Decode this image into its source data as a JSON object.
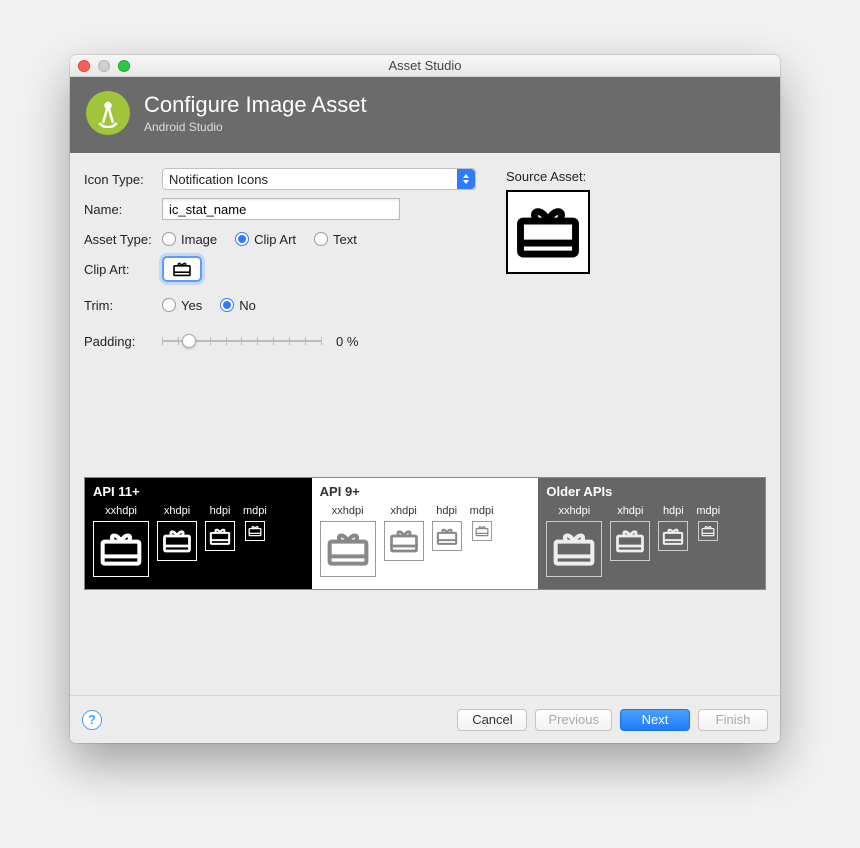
{
  "window": {
    "title": "Asset Studio"
  },
  "header": {
    "title": "Configure Image Asset",
    "subtitle": "Android Studio"
  },
  "form": {
    "iconType": {
      "label": "Icon Type:",
      "value": "Notification Icons"
    },
    "name": {
      "label": "Name:",
      "value": "ic_stat_name"
    },
    "assetType": {
      "label": "Asset Type:",
      "options": {
        "image": "Image",
        "clipArt": "Clip Art",
        "text": "Text"
      },
      "selected": "clipArt"
    },
    "clipArt": {
      "label": "Clip Art:"
    },
    "trim": {
      "label": "Trim:",
      "options": {
        "yes": "Yes",
        "no": "No"
      },
      "selected": "no"
    },
    "padding": {
      "label": "Padding:",
      "valueText": "0 %"
    }
  },
  "sourceAsset": {
    "label": "Source Asset:"
  },
  "previews": {
    "panels": [
      {
        "title": "API 11+",
        "sizes": [
          "xxhdpi",
          "xhdpi",
          "hdpi",
          "mdpi"
        ]
      },
      {
        "title": "API 9+",
        "sizes": [
          "xxhdpi",
          "xhdpi",
          "hdpi",
          "mdpi"
        ]
      },
      {
        "title": "Older APIs",
        "sizes": [
          "xxhdpi",
          "xhdpi",
          "hdpi",
          "mdpi"
        ]
      }
    ]
  },
  "footer": {
    "cancel": "Cancel",
    "previous": "Previous",
    "next": "Next",
    "finish": "Finish"
  },
  "icons": {
    "gift": "gift-icon"
  }
}
